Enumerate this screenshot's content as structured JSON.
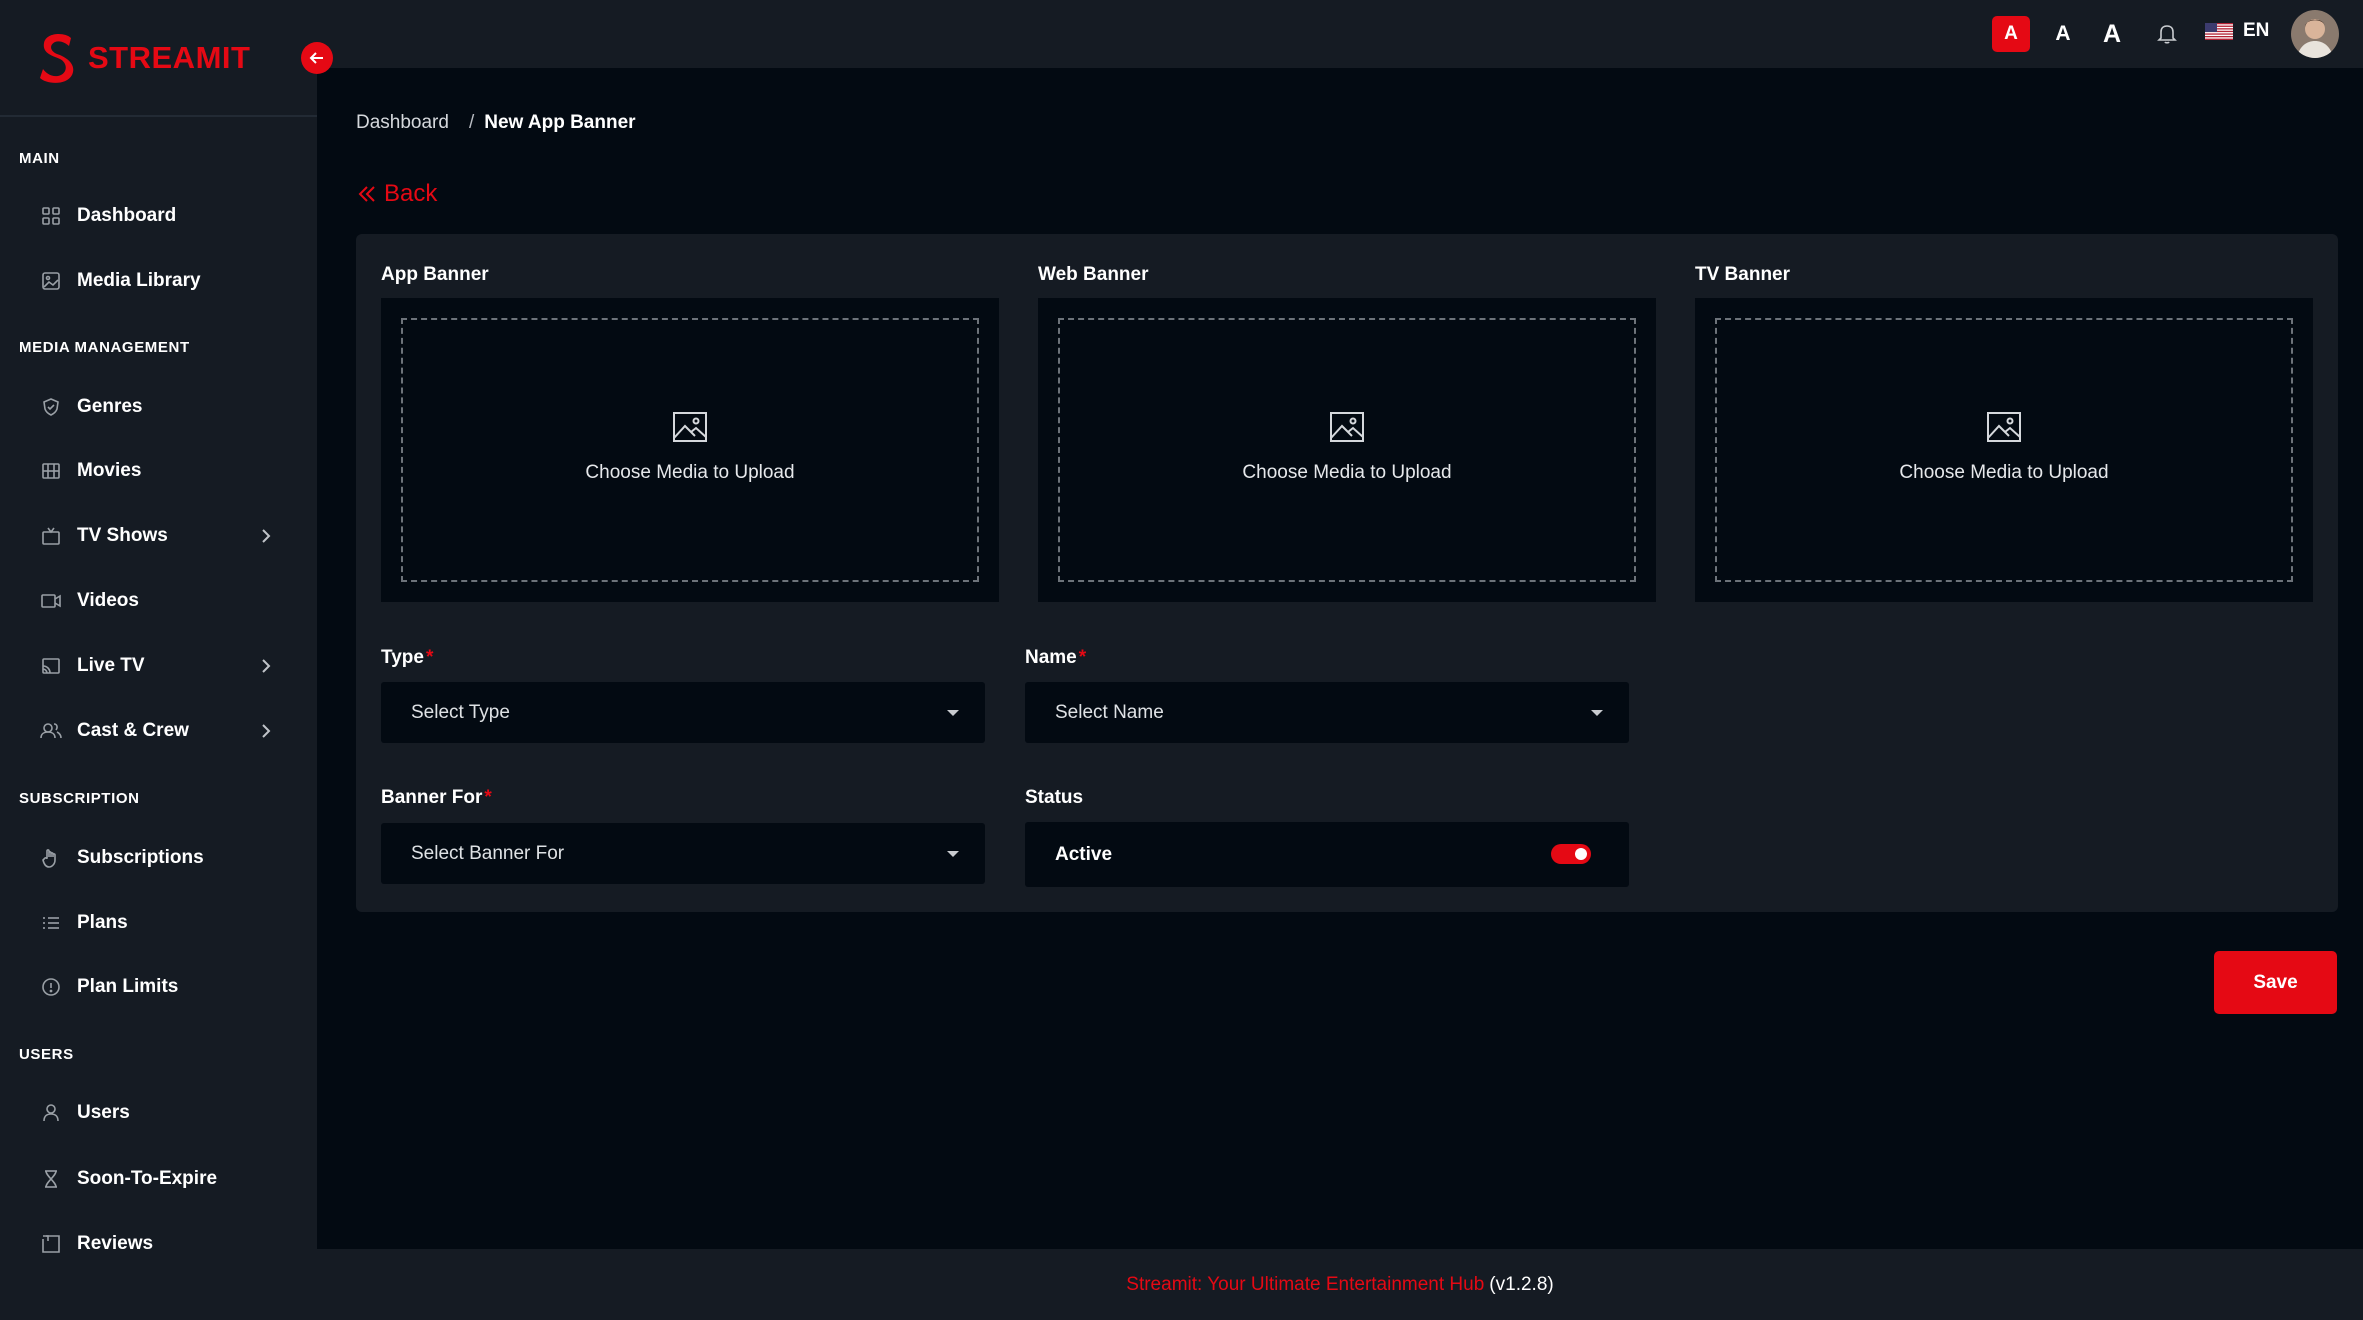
{
  "brand": {
    "name": "STREAMIT",
    "color": "#e50914"
  },
  "sidebar": {
    "sections": [
      {
        "title": "MAIN"
      },
      {
        "title": "MEDIA MANAGEMENT"
      },
      {
        "title": "SUBSCRIPTION"
      },
      {
        "title": "USERS"
      }
    ],
    "items": [
      {
        "label": "Dashboard",
        "icon": "dashboard-grid-icon"
      },
      {
        "label": "Media Library",
        "icon": "image-icon"
      },
      {
        "label": "Genres",
        "icon": "shield-icon"
      },
      {
        "label": "Movies",
        "icon": "film-icon"
      },
      {
        "label": "TV Shows",
        "icon": "tv-icon",
        "has_children": true
      },
      {
        "label": "Videos",
        "icon": "video-camera-icon"
      },
      {
        "label": "Live TV",
        "icon": "cast-icon",
        "has_children": true
      },
      {
        "label": "Cast & Crew",
        "icon": "users-icon",
        "has_children": true
      },
      {
        "label": "Subscriptions",
        "icon": "hand-icon"
      },
      {
        "label": "Plans",
        "icon": "list-icon"
      },
      {
        "label": "Plan Limits",
        "icon": "info-circle-icon"
      },
      {
        "label": "Users",
        "icon": "user-icon"
      },
      {
        "label": "Soon-To-Expire",
        "icon": "hourglass-icon"
      },
      {
        "label": "Reviews",
        "icon": "review-icon"
      }
    ]
  },
  "topbar": {
    "font_sizes": [
      "A",
      "A",
      "A"
    ],
    "active_font_size": 0,
    "language": "EN"
  },
  "breadcrumb": {
    "home": "Dashboard",
    "separator": "/",
    "current": "New App Banner"
  },
  "back_label": "Back",
  "form": {
    "uploads": [
      {
        "label": "App Banner",
        "text": "Choose Media to Upload"
      },
      {
        "label": "Web Banner",
        "text": "Choose Media to Upload"
      },
      {
        "label": "TV Banner",
        "text": "Choose Media to Upload"
      }
    ],
    "type": {
      "label": "Type",
      "required_mark": "*",
      "placeholder": "Select Type"
    },
    "name": {
      "label": "Name",
      "required_mark": "*",
      "placeholder": "Select Name"
    },
    "banner_for": {
      "label": "Banner For",
      "required_mark": "*",
      "placeholder": "Select Banner For"
    },
    "status": {
      "label": "Status",
      "value": "Active",
      "enabled": true
    }
  },
  "save_label": "Save",
  "footer": {
    "text": "Streamit: Your Ultimate Entertainment Hub",
    "version": "(v1.2.8)"
  }
}
